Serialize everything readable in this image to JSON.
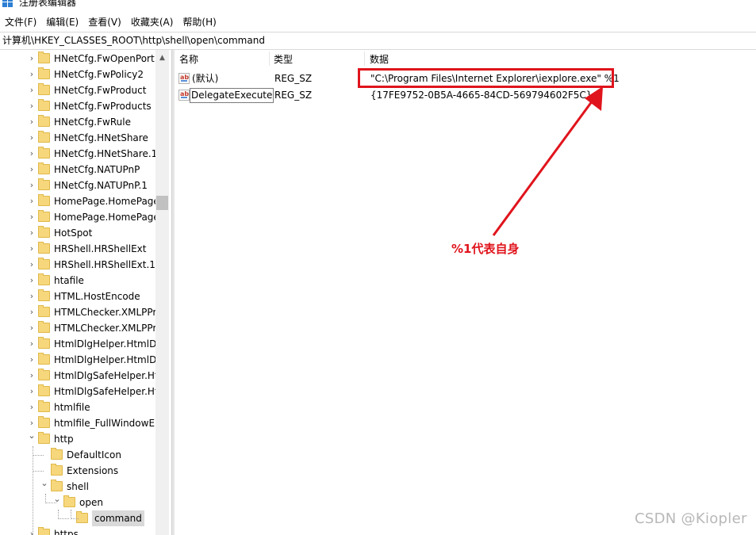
{
  "window": {
    "title": "注册表编辑器"
  },
  "menu": [
    "文件(F)",
    "编辑(E)",
    "查看(V)",
    "收藏夹(A)",
    "帮助(H)"
  ],
  "address": "计算机\\HKEY_CLASSES_ROOT\\http\\shell\\open\\command",
  "tree": {
    "items": [
      {
        "label": "HNetCfg.FwOpenPort",
        "chevron": "›"
      },
      {
        "label": "HNetCfg.FwPolicy2",
        "chevron": "›"
      },
      {
        "label": "HNetCfg.FwProduct",
        "chevron": "›"
      },
      {
        "label": "HNetCfg.FwProducts",
        "chevron": "›"
      },
      {
        "label": "HNetCfg.FwRule",
        "chevron": "›"
      },
      {
        "label": "HNetCfg.HNetShare",
        "chevron": "›"
      },
      {
        "label": "HNetCfg.HNetShare.1",
        "chevron": "›"
      },
      {
        "label": "HNetCfg.NATUPnP",
        "chevron": "›"
      },
      {
        "label": "HNetCfg.NATUPnP.1",
        "chevron": "›"
      },
      {
        "label": "HomePage.HomePage",
        "chevron": "›"
      },
      {
        "label": "HomePage.HomePage",
        "chevron": "›"
      },
      {
        "label": "HotSpot",
        "chevron": "›"
      },
      {
        "label": "HRShell.HRShellExt",
        "chevron": "›"
      },
      {
        "label": "HRShell.HRShellExt.1",
        "chevron": "›"
      },
      {
        "label": "htafile",
        "chevron": "›"
      },
      {
        "label": "HTML.HostEncode",
        "chevron": "›"
      },
      {
        "label": "HTMLChecker.XMLPPr",
        "chevron": "›"
      },
      {
        "label": "HTMLChecker.XMLPPr",
        "chevron": "›"
      },
      {
        "label": "HtmlDlgHelper.HtmlDl",
        "chevron": "›"
      },
      {
        "label": "HtmlDlgHelper.HtmlDl",
        "chevron": "›"
      },
      {
        "label": "HtmlDlgSafeHelper.Ht",
        "chevron": "›"
      },
      {
        "label": "HtmlDlgSafeHelper.Ht",
        "chevron": "›"
      },
      {
        "label": "htmlfile",
        "chevron": "›"
      },
      {
        "label": "htmlfile_FullWindowEn",
        "chevron": "›"
      },
      {
        "label": "http",
        "chevron": "⌄"
      },
      {
        "label": "DefaultIcon",
        "chevron": ""
      },
      {
        "label": "Extensions",
        "chevron": ""
      },
      {
        "label": "shell",
        "chevron": "⌄"
      },
      {
        "label": "open",
        "chevron": "⌄"
      },
      {
        "label": "command",
        "chevron": "",
        "selected": true
      },
      {
        "label": "https",
        "chevron": "›"
      }
    ]
  },
  "list": {
    "columns": [
      "名称",
      "类型",
      "数据"
    ],
    "rows": [
      {
        "icon": "ab",
        "name": "(默认)",
        "type": "REG_SZ",
        "data": "\"C:\\Program Files\\Internet Explorer\\iexplore.exe\" %1"
      },
      {
        "icon": "ab",
        "name": "DelegateExecute",
        "type": "REG_SZ",
        "data": "{17FE9752-0B5A-4665-84CD-569794602F5C}"
      }
    ]
  },
  "annotation": {
    "text": "%1代表自身",
    "color": "#e0141c"
  },
  "watermark": "CSDN @Kiopler"
}
